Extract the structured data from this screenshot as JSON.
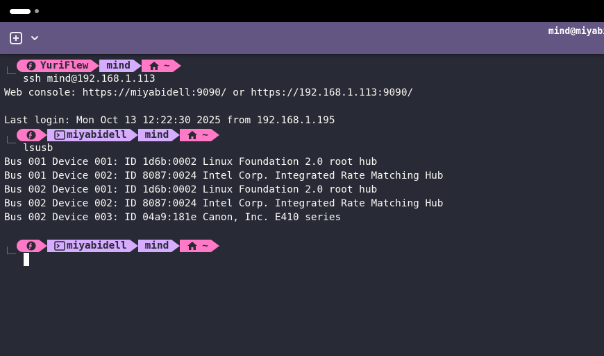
{
  "window": {
    "tab_title": "mind@miyabi"
  },
  "icons": {
    "new_tab": "plus-square-icon",
    "tab_menu": "chevron-down-icon",
    "os_logo": "fedora-icon",
    "host_terminal": "terminal-icon",
    "home": "home-icon"
  },
  "colors": {
    "background": "#282a36",
    "tab_bar": "#635682",
    "prompt_pink": "#ff79c6",
    "prompt_lilac": "#d6acff",
    "text": "#f8f8f2"
  },
  "prompts": [
    {
      "host": "YuriFlew",
      "user": "mind",
      "path": "~",
      "command": "ssh mind@192.168.1.113"
    },
    {
      "host": "miyabidell",
      "user": "mind",
      "path": "~",
      "command": "lsusb"
    },
    {
      "host": "miyabidell",
      "user": "mind",
      "path": "~",
      "command": ""
    }
  ],
  "output": {
    "ssh": [
      "Web console: https://miyabidell:9090/ or https://192.168.1.113:9090/",
      "",
      "Last login: Mon Oct 13 12:22:30 2025 from 192.168.1.195"
    ],
    "lsusb": [
      "Bus 001 Device 001: ID 1d6b:0002 Linux Foundation 2.0 root hub",
      "Bus 001 Device 002: ID 8087:0024 Intel Corp. Integrated Rate Matching Hub",
      "Bus 002 Device 001: ID 1d6b:0002 Linux Foundation 2.0 root hub",
      "Bus 002 Device 002: ID 8087:0024 Intel Corp. Integrated Rate Matching Hub",
      "Bus 002 Device 003: ID 04a9:181e Canon, Inc. E410 series"
    ]
  }
}
